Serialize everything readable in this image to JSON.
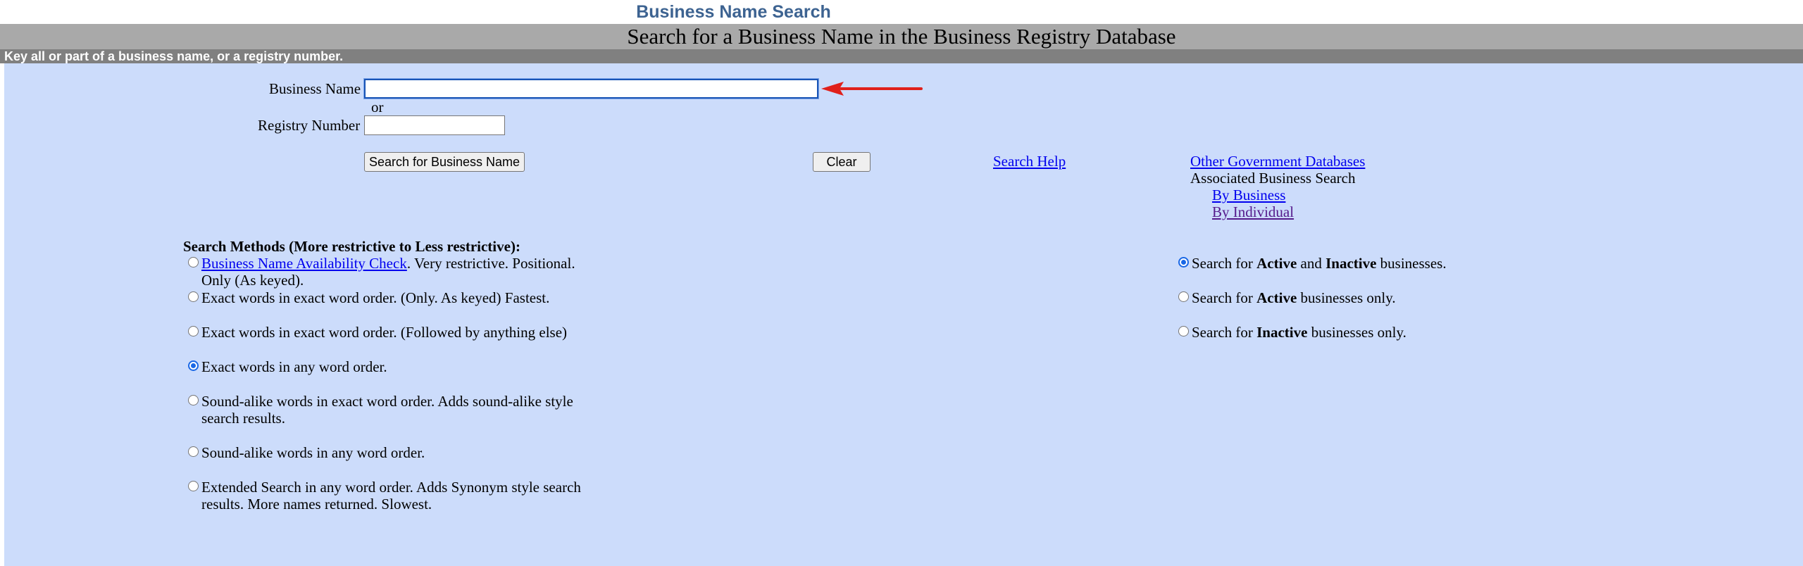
{
  "header": {
    "page_title": "Business Name Search",
    "banner": "Search for a Business Name in the Business Registry Database",
    "instruction": "Key all or part of a business name, or a registry number."
  },
  "form": {
    "business_name_label": "Business Name",
    "business_name_value": "",
    "or_text": "or",
    "registry_number_label": "Registry Number",
    "registry_number_value": ""
  },
  "actions": {
    "search_button": "Search for Business Name",
    "clear_button": "Clear",
    "search_help_link": "Search Help"
  },
  "side_links": {
    "other_databases": "Other Government Databases",
    "associated_heading": "Associated Business Search",
    "by_business": "By Business",
    "by_individual": "By Individual"
  },
  "methods": {
    "heading": "Search Methods (More restrictive to Less restrictive):",
    "options": [
      {
        "link_text": "Business Name Availability Check",
        "text": ". Very restrictive. Positional. Only (As keyed).",
        "checked": false
      },
      {
        "text": "Exact words in exact word order. (Only. As keyed) Fastest.",
        "checked": false
      },
      {
        "text": "Exact words in exact word order. (Followed by anything else)",
        "checked": false
      },
      {
        "text": "Exact words in any word order.",
        "checked": true
      },
      {
        "text": "Sound-alike words in exact word order. Adds sound-alike style search results.",
        "checked": false
      },
      {
        "text": "Sound-alike words in any word order.",
        "checked": false
      },
      {
        "text": "Extended Search in any word order. Adds Synonym style search results. More names returned. Slowest.",
        "checked": false
      }
    ]
  },
  "status_filter": {
    "options": [
      {
        "prefix": "Search for ",
        "bold1": "Active",
        "mid": " and ",
        "bold2": "Inactive",
        "suffix": " businesses.",
        "checked": true
      },
      {
        "prefix": "Search for ",
        "bold1": "Active",
        "mid": "",
        "bold2": "",
        "suffix": " businesses only.",
        "checked": false
      },
      {
        "prefix": "Search for ",
        "bold1": "Inactive",
        "mid": "",
        "bold2": "",
        "suffix": " businesses only.",
        "checked": false
      }
    ]
  },
  "colors": {
    "title_blue": "#3d6391",
    "panel_bg": "#ccdcfb",
    "banner_gray": "#a9a9a9",
    "instruction_gray": "#808080",
    "annotation_arrow": "#e0201b"
  },
  "icons": {
    "annotation": "red-arrow-pointing-left"
  }
}
